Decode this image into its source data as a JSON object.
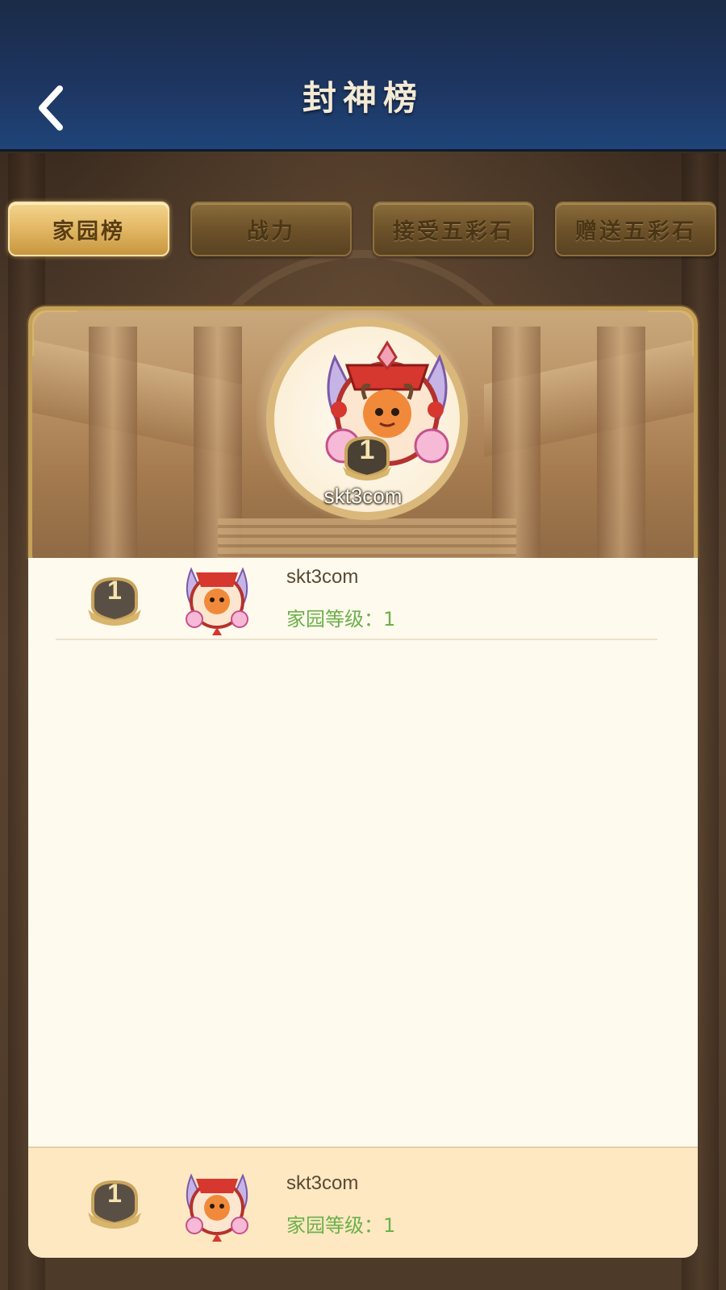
{
  "header": {
    "title": "封神榜"
  },
  "tabs": [
    {
      "label": "家园榜",
      "active": true
    },
    {
      "label": "战力",
      "active": false
    },
    {
      "label": "接受五彩石",
      "active": false
    },
    {
      "label": "赠送五彩石",
      "active": false
    }
  ],
  "banner": {
    "rank": "1",
    "name": "skt3com",
    "avatar_icon": "bull-character-avatar-icon"
  },
  "list": [
    {
      "rank": "1",
      "name": "skt3com",
      "level_label": "家园等级：",
      "level_value": "1"
    }
  ],
  "my_rank": {
    "rank": "1",
    "name": "skt3com",
    "level_label": "家园等级：",
    "level_value": "1"
  },
  "colors": {
    "header_blue": "#1d3560",
    "tab_active_gold": "#e2b764",
    "level_green": "#6cb04a",
    "panel_bg": "#fffaee",
    "my_row_bg": "#fde8c2"
  }
}
